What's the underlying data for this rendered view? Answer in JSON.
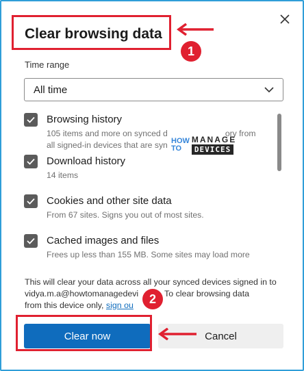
{
  "dialog": {
    "title": "Clear browsing data",
    "close_icon": "close-icon"
  },
  "time_range": {
    "label": "Time range",
    "selected": "All time",
    "icon": "chevron-down-icon"
  },
  "options": [
    {
      "title": "Browsing history",
      "desc_line1": "105 items and more on synced d",
      "desc_line1_end": "ory from",
      "desc_line2": "all signed-in devices that are syn",
      "checked": true
    },
    {
      "title": "Download history",
      "desc": "14 items",
      "checked": true
    },
    {
      "title": "Cookies and other site data",
      "desc": "From 67 sites. Signs you out of most sites.",
      "checked": true
    },
    {
      "title": "Cached images and files",
      "desc": "Frees up less than 155 MB. Some sites may load more",
      "checked": true
    }
  ],
  "footer": {
    "line1": "This will clear your data across all your synced devices signed in to",
    "line2": "vidya.m.a@howtomanagedevi",
    "line2_end": "om. To clear browsing data",
    "line3": "from this device only,",
    "link": "sign ou"
  },
  "buttons": {
    "clear": "Clear now",
    "cancel": "Cancel"
  },
  "annotations": {
    "badge1": "1",
    "badge2": "2",
    "color": "#e02030"
  },
  "watermark": {
    "how_line1": "HOW",
    "how_line2": "TO",
    "manage": "MANAGE",
    "devices": "DEVICES"
  },
  "colors": {
    "accent": "#0f6cbd",
    "frame": "#2f9ed8",
    "checkbox": "#5b5b5b"
  }
}
